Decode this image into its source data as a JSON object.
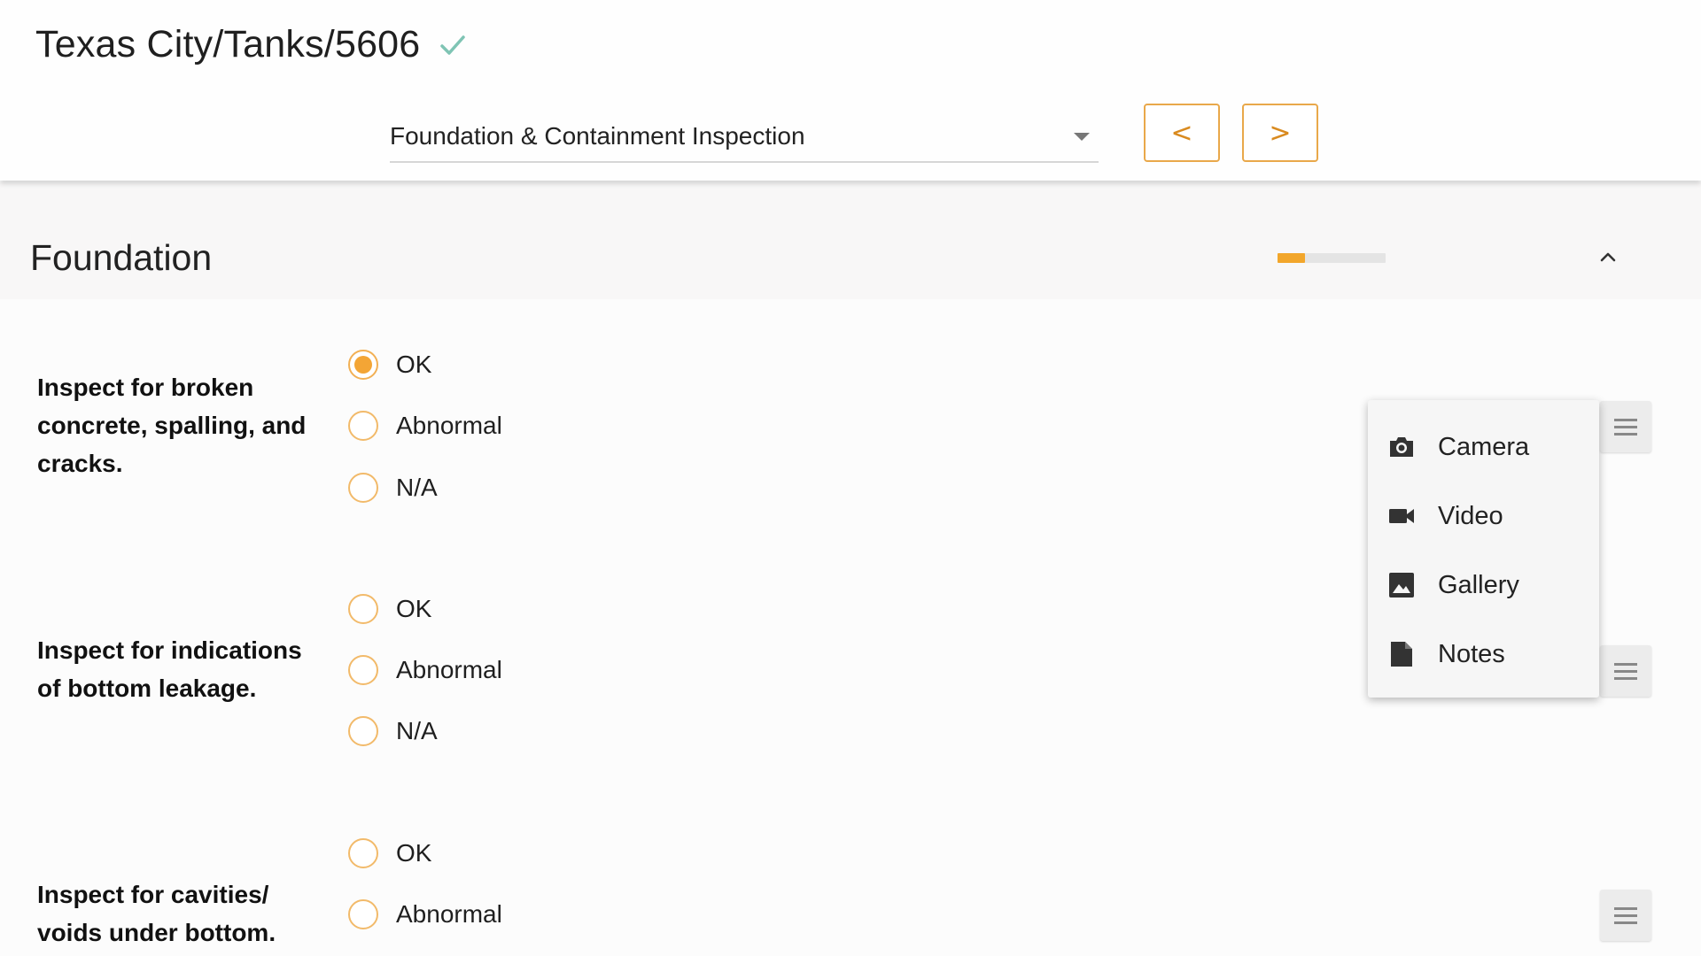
{
  "header": {
    "title": "Texas City/Tanks/5606",
    "status_icon": "check-icon",
    "inspection_select": {
      "value": "Foundation & Containment Inspection"
    },
    "prev_label": "<",
    "next_label": ">"
  },
  "section": {
    "title": "Foundation",
    "progress": 0.25,
    "accent_color": "#f2a62b"
  },
  "questions": [
    {
      "text": "Inspect for broken concrete, spalling, and cracks.",
      "options": [
        "OK",
        "Abnormal",
        "N/A"
      ],
      "selected": "OK"
    },
    {
      "text": "Inspect for indications of bottom leakage.",
      "options": [
        "OK",
        "Abnormal",
        "N/A"
      ],
      "selected": null
    },
    {
      "text": "Inspect for cavities/ voids under bottom.",
      "options": [
        "OK",
        "Abnormal"
      ],
      "selected": null
    }
  ],
  "attachment_menu": {
    "items": [
      {
        "label": "Camera",
        "icon": "camera-icon"
      },
      {
        "label": "Video",
        "icon": "video-icon"
      },
      {
        "label": "Gallery",
        "icon": "gallery-icon"
      },
      {
        "label": "Notes",
        "icon": "notes-icon"
      }
    ]
  }
}
